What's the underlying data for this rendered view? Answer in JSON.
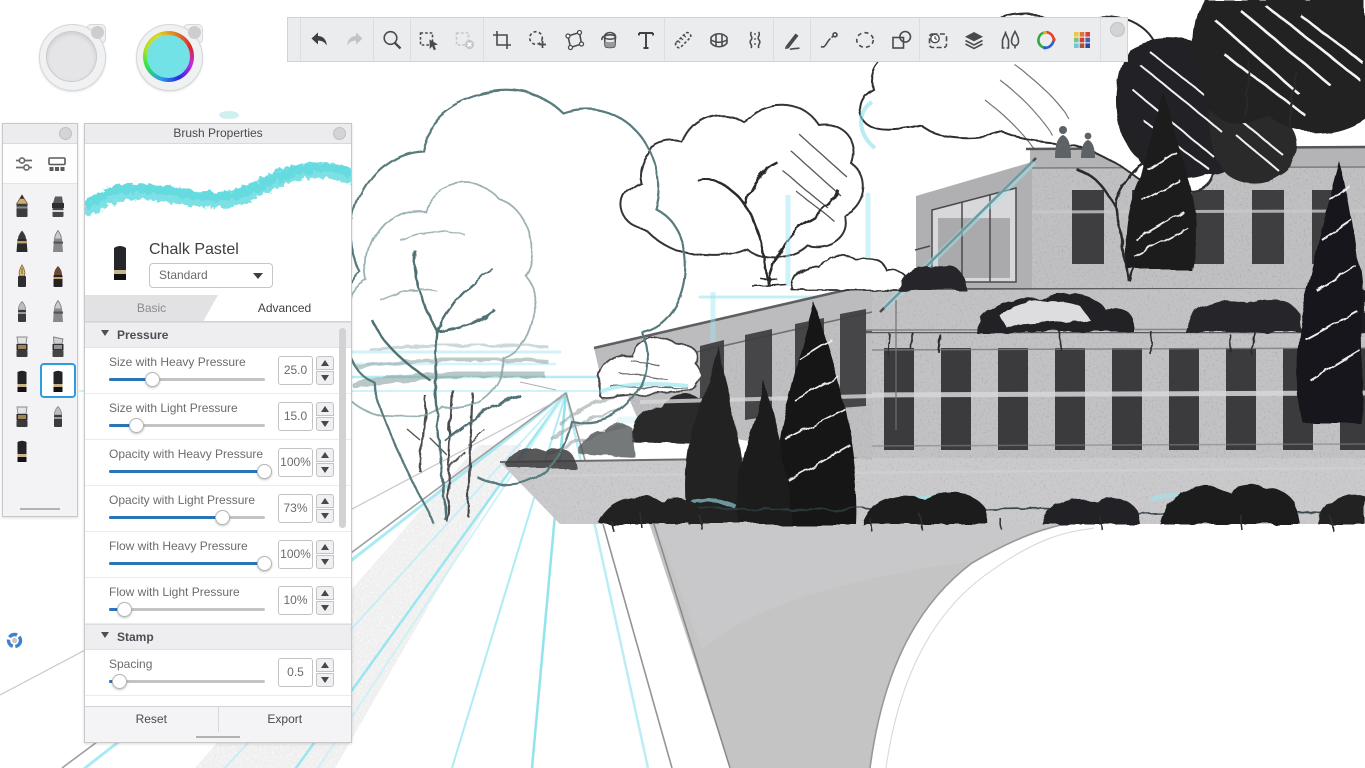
{
  "pucks": {
    "brush": {
      "name": "brush-puck"
    },
    "color": {
      "name": "color-puck",
      "current_color": "#72e2e6"
    }
  },
  "toolbar": {
    "items": [
      {
        "name": "undo"
      },
      {
        "name": "redo"
      },
      {
        "name": "zoom"
      },
      {
        "name": "select"
      },
      {
        "name": "deselect"
      },
      {
        "name": "crop"
      },
      {
        "name": "lasso-add"
      },
      {
        "name": "distort"
      },
      {
        "name": "fill"
      },
      {
        "name": "text"
      },
      {
        "name": "ruler"
      },
      {
        "name": "perspective"
      },
      {
        "name": "symmetry"
      },
      {
        "name": "stroke-pen"
      },
      {
        "name": "predictive-stroke"
      },
      {
        "name": "ellipse"
      },
      {
        "name": "shapes"
      },
      {
        "name": "timelapse"
      },
      {
        "name": "layers"
      },
      {
        "name": "brush-library"
      },
      {
        "name": "color-editor"
      },
      {
        "name": "color-palette"
      }
    ],
    "groups_after": [
      1,
      2,
      4,
      9,
      12,
      13,
      16
    ]
  },
  "brush_palette": {
    "views": [
      {
        "name": "slider-view"
      },
      {
        "name": "library-view"
      }
    ],
    "brushes": [
      {
        "name": "pencil",
        "type": "pencil"
      },
      {
        "name": "eraser",
        "type": "stub"
      },
      {
        "name": "airbrush",
        "type": "cone"
      },
      {
        "name": "soft-airbrush",
        "type": "cone2"
      },
      {
        "name": "ink-pen",
        "type": "nib"
      },
      {
        "name": "round-brush",
        "type": "round"
      },
      {
        "name": "paint-brush",
        "type": "round2"
      },
      {
        "name": "silver-airbrush",
        "type": "cone2"
      },
      {
        "name": "marker",
        "type": "flat"
      },
      {
        "name": "chisel-marker",
        "type": "flat2"
      },
      {
        "name": "chalk",
        "type": "chalk"
      },
      {
        "name": "chalk-pastel",
        "type": "chalk"
      },
      {
        "name": "flat-brush",
        "type": "flat"
      },
      {
        "name": "smudge-stump",
        "type": "round2"
      },
      {
        "name": "wide-marker",
        "type": "chalk"
      }
    ],
    "selected_index": 11
  },
  "brush_properties": {
    "title": "Brush Properties",
    "brush_name": "Chalk Pastel",
    "preset": "Standard",
    "tabs": {
      "basic": "Basic",
      "advanced": "Advanced",
      "active": "Advanced"
    },
    "sections": [
      {
        "title": "Pressure",
        "sliders": [
          {
            "label": "Size with Heavy Pressure",
            "value": "25.0",
            "fraction": 0.28
          },
          {
            "label": "Size with Light Pressure",
            "value": "15.0",
            "fraction": 0.18
          },
          {
            "label": "Opacity with Heavy Pressure",
            "value": "100%",
            "fraction": 1.0
          },
          {
            "label": "Opacity with Light Pressure",
            "value": "73%",
            "fraction": 0.73
          },
          {
            "label": "Flow with Heavy Pressure",
            "value": "100%",
            "fraction": 1.0
          },
          {
            "label": "Flow with Light Pressure",
            "value": "10%",
            "fraction": 0.1
          }
        ]
      },
      {
        "title": "Stamp",
        "sliders": [
          {
            "label": "Spacing",
            "value": "0.5",
            "fraction": 0.07
          }
        ]
      }
    ],
    "buttons": {
      "reset": "Reset",
      "export": "Export"
    }
  },
  "status": {
    "sync_icon": "syncing"
  }
}
